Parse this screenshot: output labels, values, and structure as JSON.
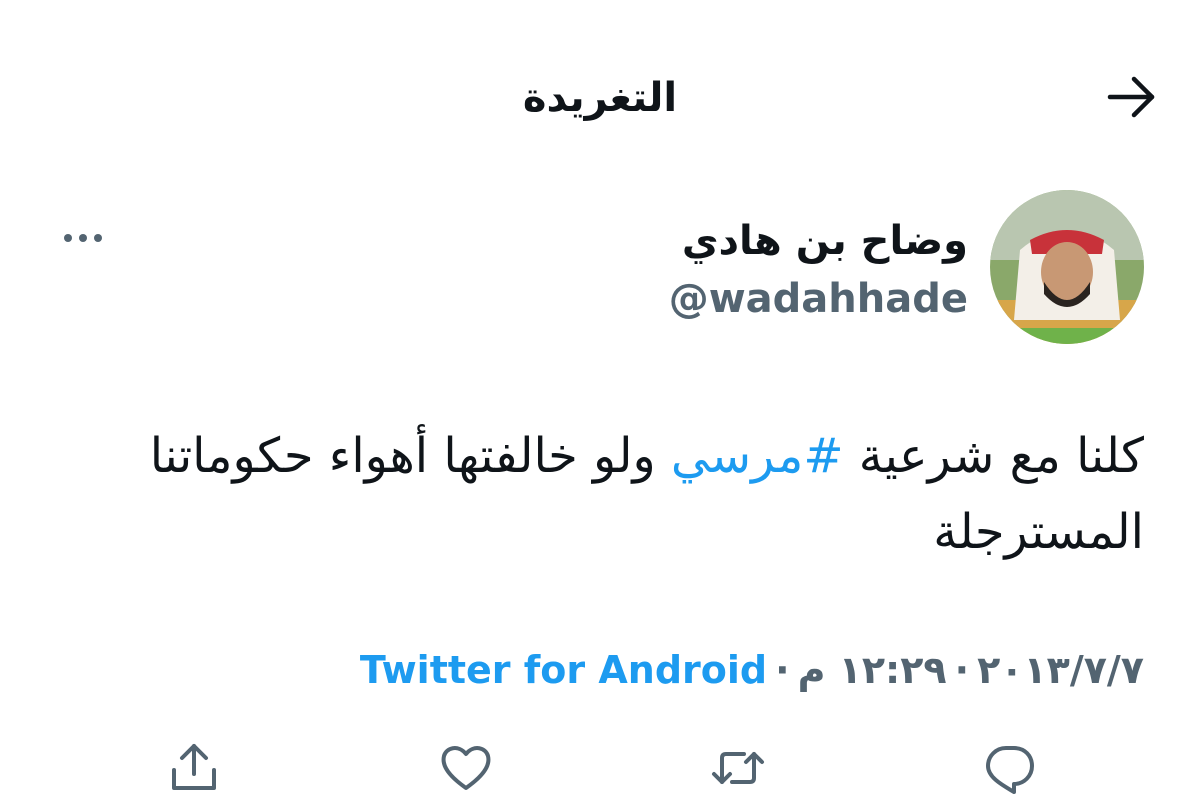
{
  "header": {
    "title": "التغريدة"
  },
  "author": {
    "name": "وضاح بن هادي",
    "handle": "@wadahhade"
  },
  "tweet": {
    "text_before": "كلنا مع شرعية ",
    "hashtag": "#مرسي",
    "text_after": " ولو خالفتها أهواء حكوماتنا المسترجلة"
  },
  "meta": {
    "date": "٢٠١٣/٧/٧",
    "time": "١٢:٢٩ م",
    "separator": "·",
    "source": "Twitter for Android"
  },
  "icons": {
    "back": "arrow-right-icon",
    "more": "more-horizontal-icon",
    "reply": "reply-icon",
    "retweet": "retweet-icon",
    "like": "heart-icon",
    "share": "share-icon"
  },
  "colors": {
    "link": "#1d9bf0",
    "text": "#0f1419",
    "secondary": "#536471"
  }
}
